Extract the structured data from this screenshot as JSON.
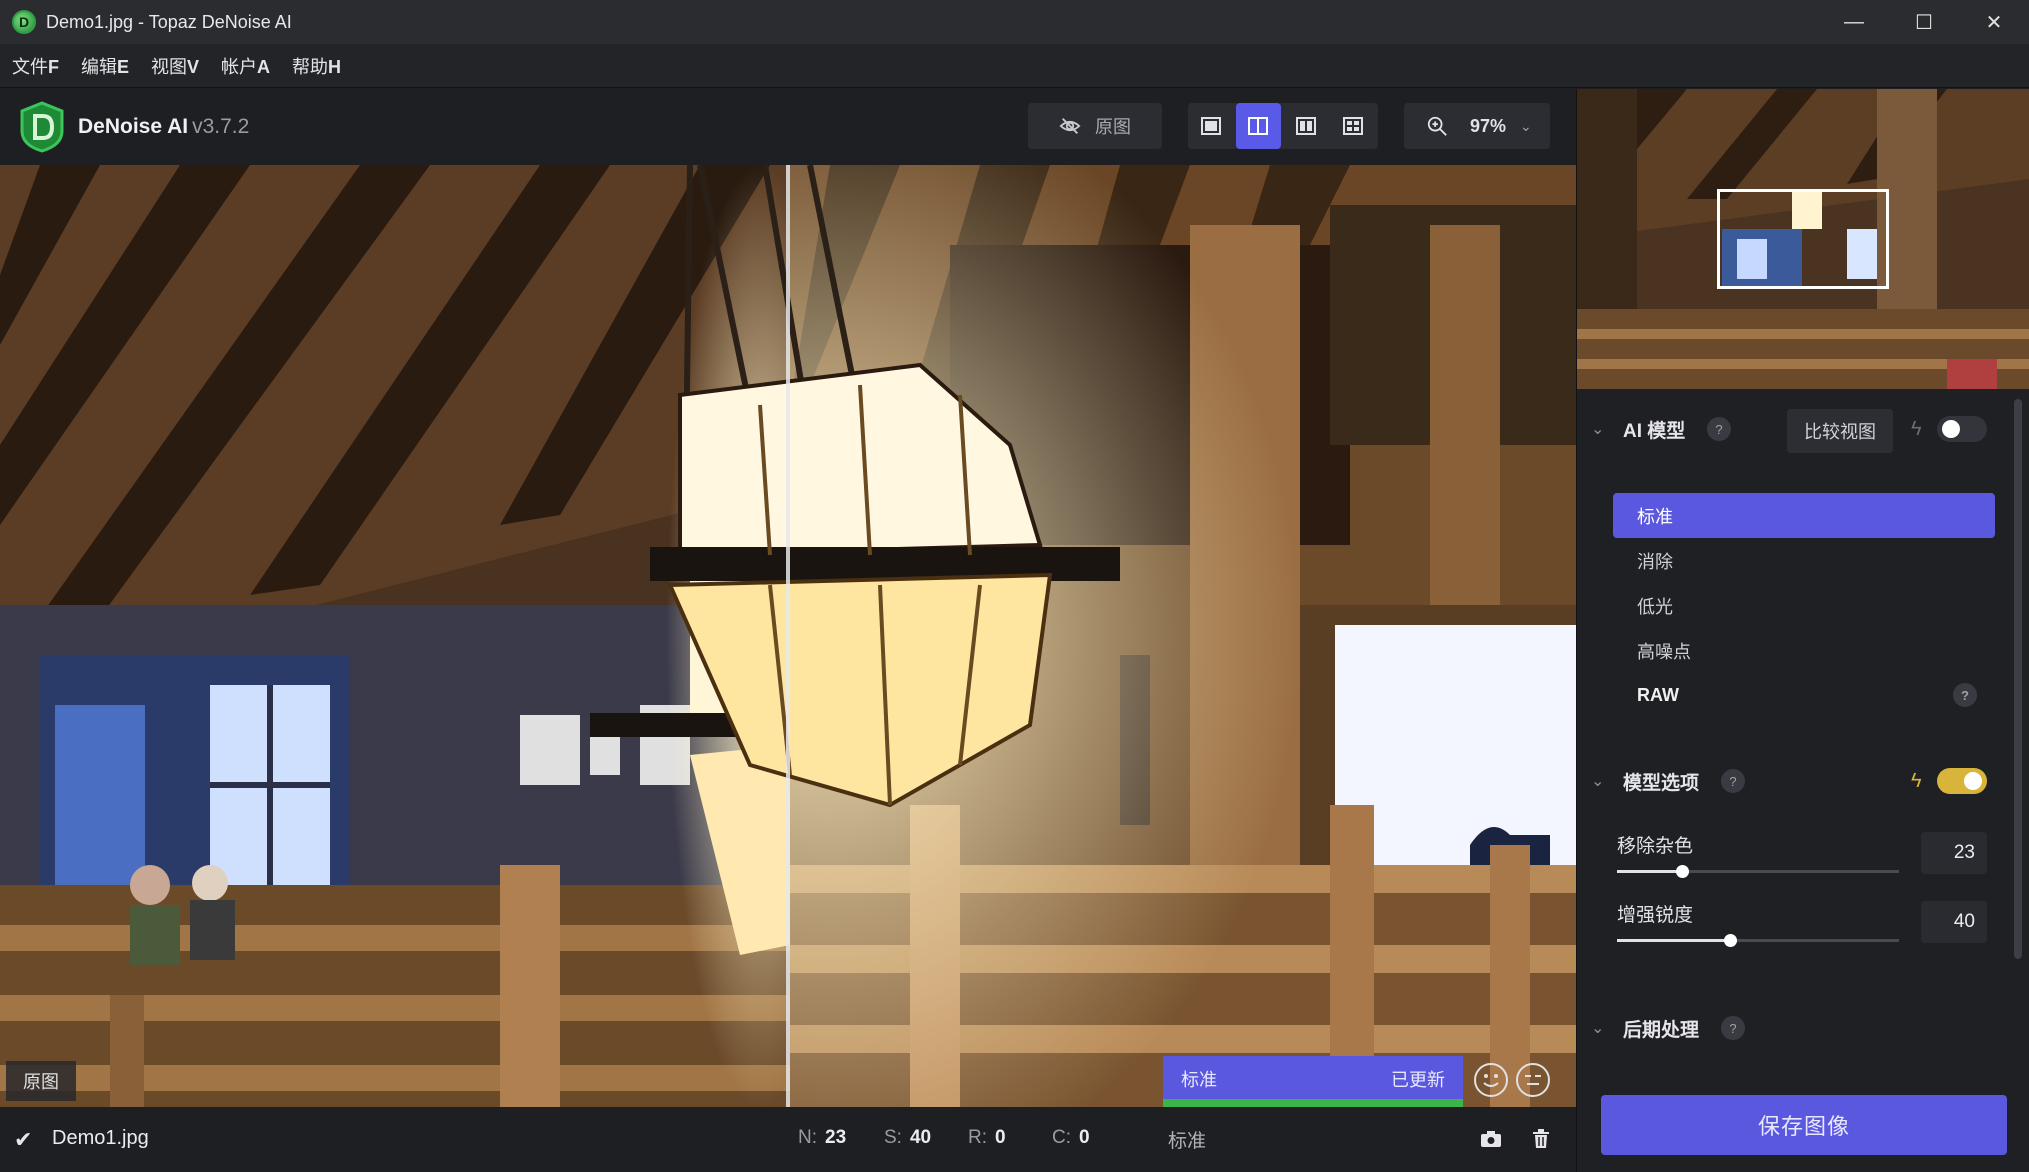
{
  "window": {
    "title": "Demo1.jpg - Topaz DeNoise AI",
    "icon_letter": "D",
    "minimize": "—",
    "maximize": "☐",
    "close": "✕"
  },
  "menu": [
    {
      "label": "文件",
      "key": "F"
    },
    {
      "label": "编辑",
      "key": "E"
    },
    {
      "label": "视图",
      "key": "V"
    },
    {
      "label": "帐户",
      "key": "A"
    },
    {
      "label": "帮助",
      "key": "H"
    }
  ],
  "toolbar": {
    "app_name": "DeNoise AI",
    "version": "v3.7.2",
    "original_label": "原图",
    "zoom": "97%",
    "active_view": "split"
  },
  "image": {
    "original_tag": "原图",
    "status_model": "标准",
    "status_updated": "已更新"
  },
  "statusbar": {
    "filename": "Demo1.jpg",
    "n_label": "N:",
    "n_value": "23",
    "s_label": "S:",
    "s_value": "40",
    "r_label": "R:",
    "r_value": "0",
    "c_label": "C:",
    "c_value": "0",
    "model": "标准"
  },
  "panel": {
    "ai_model": {
      "title": "AI 模型",
      "help": "?",
      "compare_label": "比较视图",
      "toggle_on": false,
      "models": [
        {
          "label": "标准",
          "selected": true
        },
        {
          "label": "消除",
          "selected": false
        },
        {
          "label": "低光",
          "selected": false
        },
        {
          "label": "高噪点",
          "selected": false
        },
        {
          "label": "RAW",
          "selected": false
        }
      ]
    },
    "model_options": {
      "title": "模型选项",
      "help": "?",
      "auto_on": true,
      "sliders": [
        {
          "label": "移除杂色",
          "value": "23",
          "fraction": 0.23
        },
        {
          "label": "增强锐度",
          "value": "40",
          "fraction": 0.4
        }
      ]
    },
    "post": {
      "title": "后期处理",
      "help": "?"
    },
    "save_label": "保存图像"
  },
  "colors": {
    "accent": "#5b58e0",
    "progress": "#3bb54a",
    "toggle_on": "#d9b43a"
  }
}
